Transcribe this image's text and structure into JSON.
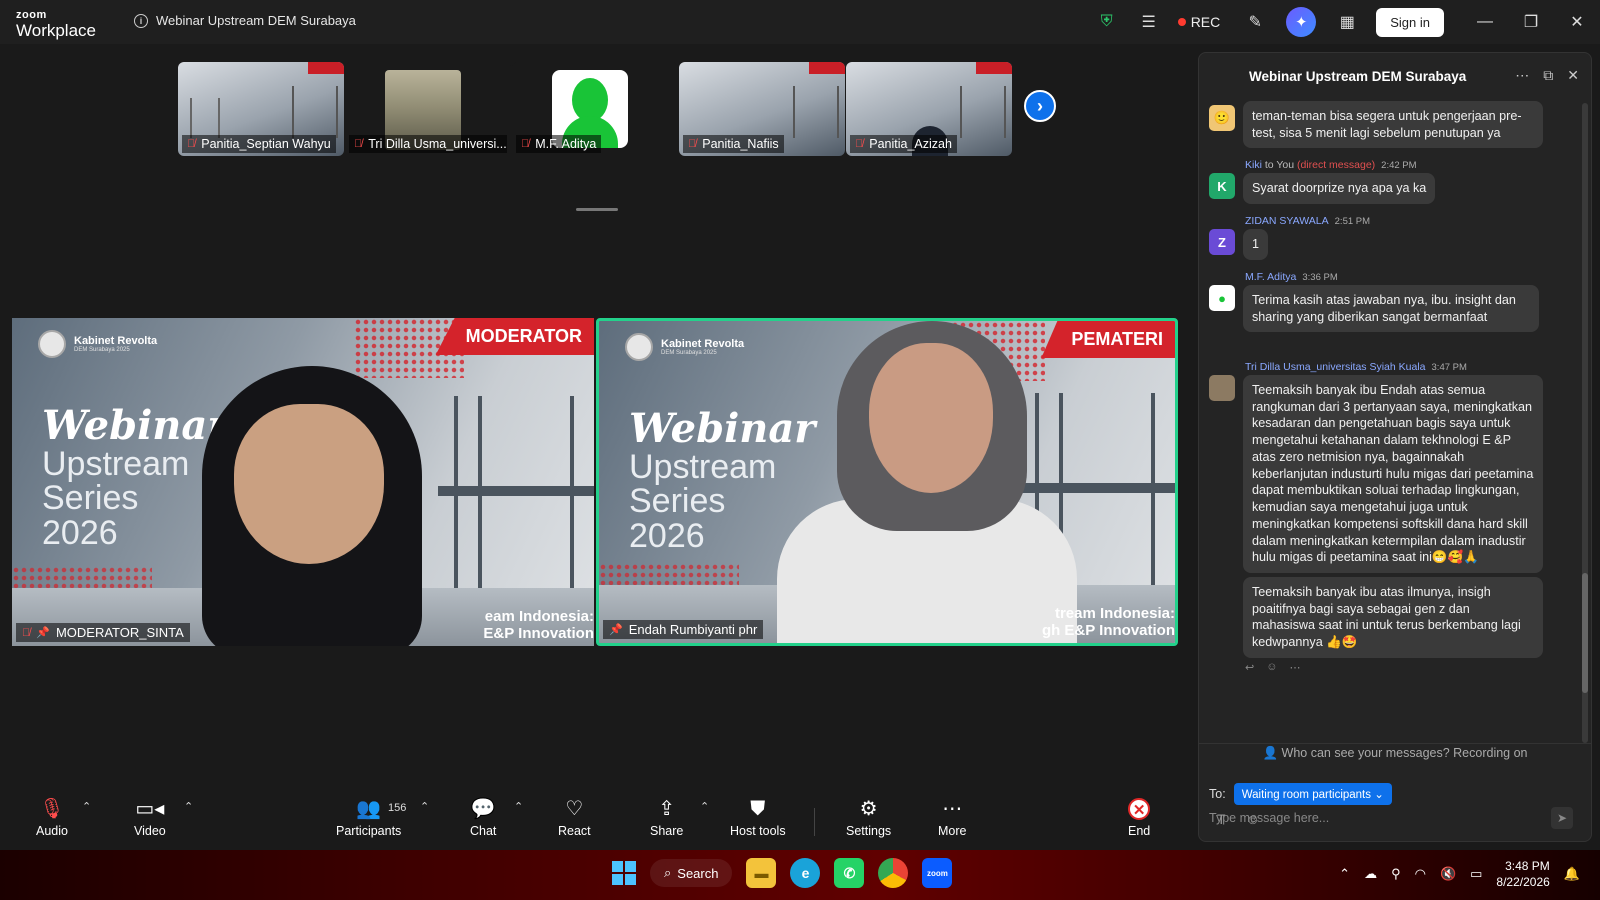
{
  "app": {
    "logo_line1": "zoom",
    "logo_line2": "Workplace",
    "meeting_title": "Webinar Upstream DEM Surabaya",
    "rec_label": "REC",
    "signin_label": "Sign in"
  },
  "thumbnails": [
    {
      "name": "Panitia_Septian Wahyu",
      "kind": "poster"
    },
    {
      "name": "Tri Dilla Usma_universi...",
      "kind": "photo"
    },
    {
      "name": "M.F. Aditya",
      "kind": "avatar"
    },
    {
      "name": "Panitia_Nafiis",
      "kind": "poster"
    },
    {
      "name": "Panitia_Azizah",
      "kind": "poster"
    }
  ],
  "videos": {
    "left": {
      "name": "MODERATOR_SINTA",
      "tag": "MODERATOR"
    },
    "right": {
      "name": "Endah Rumbiyanti phr",
      "tag": "PEMATERI"
    }
  },
  "toolbar": {
    "audio": "Audio",
    "video": "Video",
    "participants": "Participants",
    "participants_count": "156",
    "chat": "Chat",
    "react": "React",
    "share": "Share",
    "host_tools": "Host tools",
    "settings": "Settings",
    "more": "More",
    "end": "End"
  },
  "chat": {
    "title": "Webinar Upstream DEM Surabaya",
    "messages": [
      {
        "sender": "",
        "time": "",
        "text": "teman-teman bisa segera untuk pengerjaan pre-test, sisa 5 menit lagi sebelum penutupan ya"
      },
      {
        "sender": "Kiki",
        "to": "to You",
        "dm": "(direct message)",
        "time": "2:42 PM",
        "avatar": "K",
        "text": "Syarat doorprize nya apa ya ka"
      },
      {
        "sender": "ZIDAN SYAWALA",
        "time": "2:51 PM",
        "avatar": "Z",
        "text": "1"
      },
      {
        "sender": "M.F. Aditya",
        "time": "3:36 PM",
        "text": "Terima kasih atas jawaban nya, ibu. insight dan sharing yang diberikan sangat bermanfaat"
      },
      {
        "sender": "Tri Dilla Usma_universitas Syiah Kuala",
        "time": "3:47 PM",
        "text": "Teemaksih banyak ibu Endah atas semua rangkuman dari 3 pertanyaan saya, meningkatkan kesadaran dan pengetahuan bagis saya untuk mengetahui ketahanan dalam tekhnologi E &P atas zero netmision nya, bagainnakah keberlanjutan industurti hulu migas dari peetamina dapat membuktikan soluai terhadap lingkungan, kemudian saya mengetahui juga untuk meningkatkan kompetensi softskill dana hard skill dalam meningkatkan ketermpilan dalam inadustir hulu migas di peetamina saat ini😁🥰🙏"
      },
      {
        "sender": "",
        "time": "",
        "text": "Teemaksih banyak ibu atas ilmunya, insigh poaitifnya bagi saya sebagai gen z dan mahasiswa saat ini untuk terus berkembang lagi kedwpannya 👍🤩"
      }
    ],
    "privacy_note": "Who can see your messages? Recording on",
    "to_label": "To:",
    "to_value": "Waiting room participants ⌄",
    "input_placeholder": "Type message here..."
  },
  "taskbar": {
    "search_label": "Search",
    "time": "3:48 PM",
    "date": "8/22/2026"
  }
}
